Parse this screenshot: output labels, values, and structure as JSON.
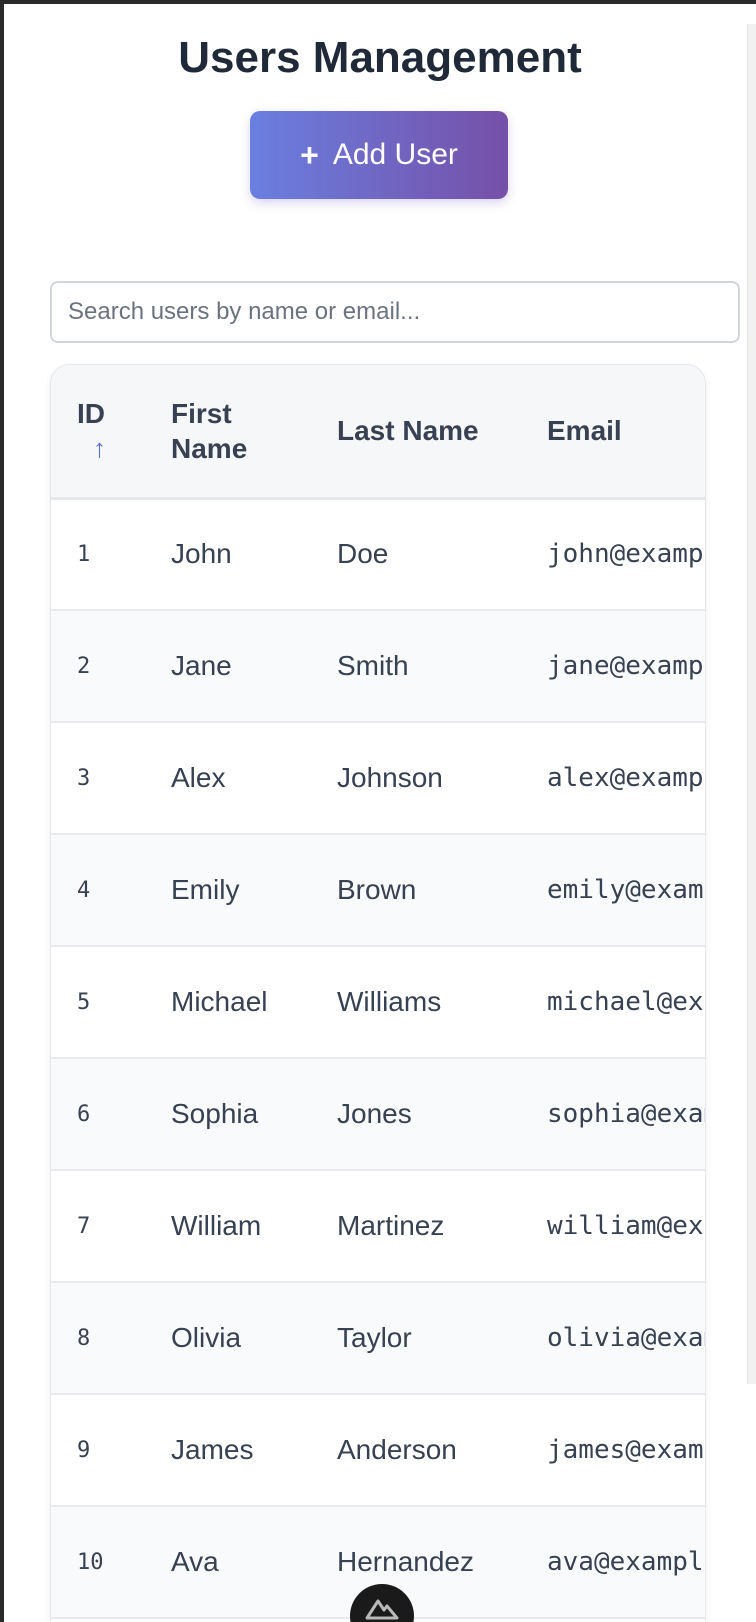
{
  "page": {
    "title": "Users Management"
  },
  "toolbar": {
    "add_user_label": "Add User",
    "add_user_icon": "plus-icon"
  },
  "search": {
    "placeholder": "Search users by name or email...",
    "value": ""
  },
  "table": {
    "columns": [
      {
        "label": "ID",
        "sort": "↑"
      },
      {
        "label": "First Name"
      },
      {
        "label": "Last Name"
      },
      {
        "label": "Email"
      }
    ],
    "rows": [
      {
        "id": "1",
        "first": "John",
        "last": "Doe",
        "email": "john@example.com"
      },
      {
        "id": "2",
        "first": "Jane",
        "last": "Smith",
        "email": "jane@example.com"
      },
      {
        "id": "3",
        "first": "Alex",
        "last": "Johnson",
        "email": "alex@example.com"
      },
      {
        "id": "4",
        "first": "Emily",
        "last": "Brown",
        "email": "emily@example.com"
      },
      {
        "id": "5",
        "first": "Michael",
        "last": "Williams",
        "email": "michael@example.com"
      },
      {
        "id": "6",
        "first": "Sophia",
        "last": "Jones",
        "email": "sophia@example.com"
      },
      {
        "id": "7",
        "first": "William",
        "last": "Martinez",
        "email": "william@example.com"
      },
      {
        "id": "8",
        "first": "Olivia",
        "last": "Taylor",
        "email": "olivia@example.com"
      },
      {
        "id": "9",
        "first": "James",
        "last": "Anderson",
        "email": "james@example.com"
      },
      {
        "id": "10",
        "first": "Ava",
        "last": "Hernandez",
        "email": "ava@example.com"
      }
    ]
  },
  "floating_button": {
    "icon": "nuxt-logo-icon"
  },
  "colors": {
    "accent_start": "#6a7fe0",
    "accent_end": "#7650a8",
    "text": "#1f2937",
    "sort_arrow": "#5b6fd8"
  }
}
